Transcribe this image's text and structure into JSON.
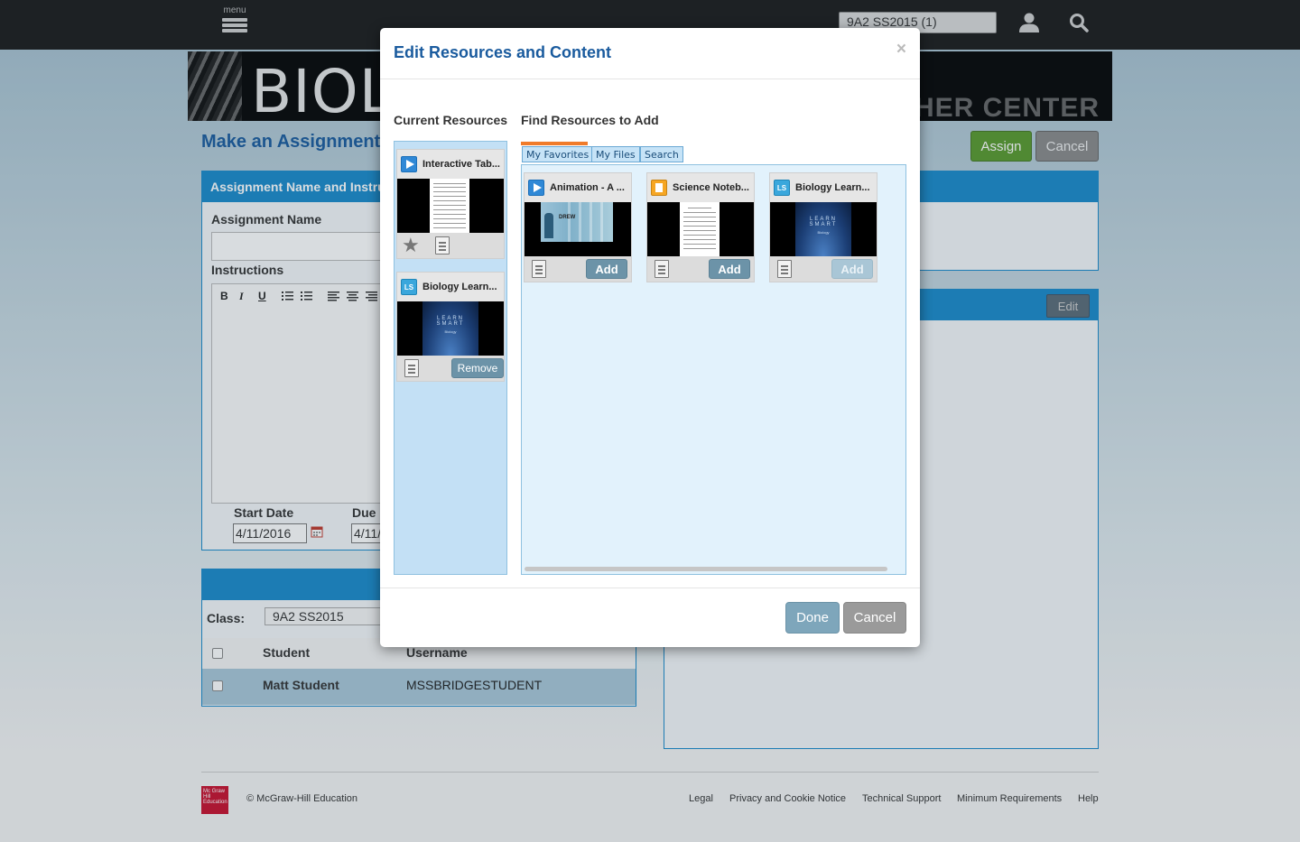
{
  "topbar": {
    "menu_label": "menu",
    "class_selector": "9A2 SS2015 (1)"
  },
  "banner": {
    "title_visible": "BIOLO",
    "right_title_visible": "CHER CENTER"
  },
  "page": {
    "heading": "Make an Assignment",
    "assign_label": "Assign",
    "cancel_label": "Cancel",
    "panel1_header": "Assignment Name and Instru",
    "assignment_name_label": "Assignment Name",
    "instructions_label": "Instructions",
    "rte_buttons": [
      "B",
      "I",
      "U"
    ],
    "start_date_label": "Start Date",
    "start_date_value": "4/11/2016",
    "due_label": "Due",
    "due_value": "4/11/",
    "edit_label": "Edit",
    "class_label": "Class:",
    "class_value": "9A2 SS2015",
    "student_col": "Student",
    "username_col": "Username",
    "student_name": "Matt Student",
    "student_username": "MSSBRIDGESTUDENT"
  },
  "footer": {
    "logo_text": "Mc Graw Hill Education",
    "copyright": "© McGraw-Hill Education",
    "links": [
      "Legal",
      "Privacy and Cookie Notice",
      "Technical Support",
      "Minimum Requirements",
      "Help"
    ]
  },
  "modal": {
    "title": "Edit Resources and Content",
    "close_glyph": "×",
    "current_label": "Current Resources",
    "find_label": "Find Resources to Add",
    "tabs": [
      "My Favorites",
      "My Files",
      "Search"
    ],
    "active_tab": "My Favorites",
    "current_resources": [
      {
        "title": "Interactive Tab...",
        "icon": "play-video-icon",
        "action": ""
      },
      {
        "title": "Biology Learn...",
        "icon": "learnsmart-icon",
        "action": "Remove",
        "thumb_t1": "LEARN SMART",
        "thumb_t2": "Biology"
      }
    ],
    "find_resources": [
      {
        "title": "Animation - A ...",
        "icon": "play-video-icon",
        "action": "Add",
        "enabled": true,
        "thumb_label": "DREW"
      },
      {
        "title": "Science Noteb...",
        "icon": "notebook-icon",
        "action": "Add",
        "enabled": true
      },
      {
        "title": "Biology Learn...",
        "icon": "learnsmart-icon",
        "action": "Add",
        "enabled": false,
        "thumb_t1": "LEARN SMART",
        "thumb_t2": "Biology"
      }
    ],
    "done_label": "Done",
    "cancel_label": "Cancel"
  },
  "colors": {
    "accent_blue": "#1a5b9e",
    "panel_blue": "#1a8acb",
    "assign_green": "#5a9a2e",
    "tab_accent": "#f07b2a",
    "button_blue": "#6c93a8"
  }
}
